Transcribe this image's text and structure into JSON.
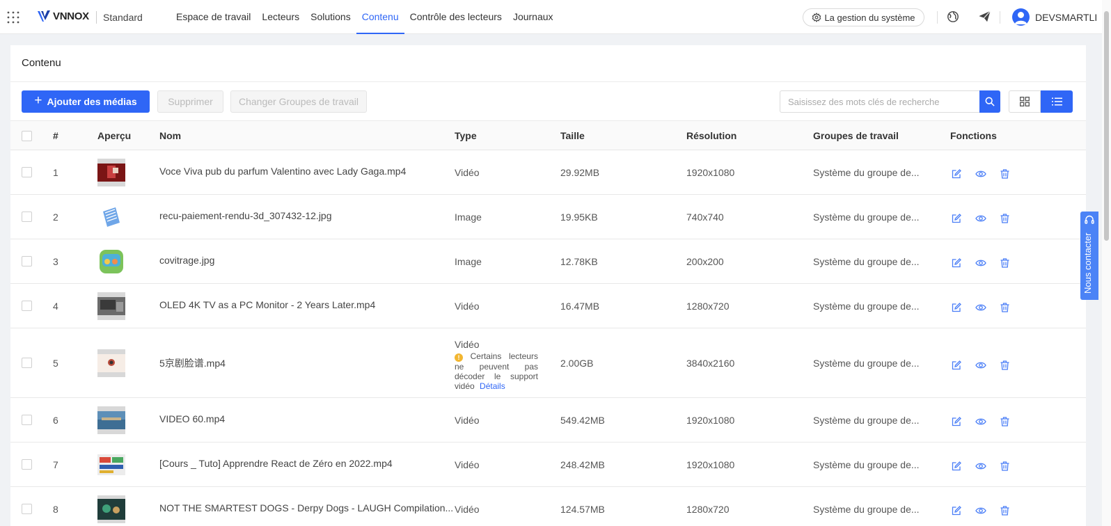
{
  "brand": {
    "name": "VNNOX",
    "edition": "Standard"
  },
  "nav": {
    "items": [
      {
        "label": "Espace de travail",
        "active": false
      },
      {
        "label": "Lecteurs",
        "active": false
      },
      {
        "label": "Solutions",
        "active": false
      },
      {
        "label": "Contenu",
        "active": true
      },
      {
        "label": "Contrôle des lecteurs",
        "active": false
      },
      {
        "label": "Journaux",
        "active": false
      }
    ],
    "system_label": "La gestion du système",
    "username": "DEVSMARTLIG"
  },
  "page": {
    "title": "Contenu"
  },
  "toolbar": {
    "add_label": "Ajouter des médias",
    "delete_label": "Supprimer",
    "change_group_label": "Changer Groupes de travail",
    "search_placeholder": "Saisissez des mots clés de recherche"
  },
  "table": {
    "headers": [
      "#",
      "Aperçu",
      "Nom",
      "Type",
      "Taille",
      "Résolution",
      "Groupes de travail",
      "Fonctions"
    ],
    "rows": [
      {
        "num": "1",
        "name": "Voce Viva pub du parfum Valentino avec Lady Gaga.mp4",
        "type": "Vidéo",
        "size": "29.92MB",
        "resolution": "1920x1080",
        "group": "Système du groupe de..."
      },
      {
        "num": "2",
        "name": "recu-paiement-rendu-3d_307432-12.jpg",
        "type": "Image",
        "size": "19.95KB",
        "resolution": "740x740",
        "group": "Système du groupe de..."
      },
      {
        "num": "3",
        "name": "covitrage.jpg",
        "type": "Image",
        "size": "12.78KB",
        "resolution": "200x200",
        "group": "Système du groupe de..."
      },
      {
        "num": "4",
        "name": "OLED 4K TV as a PC Monitor - 2 Years Later.mp4",
        "type": "Vidéo",
        "size": "16.47MB",
        "resolution": "1280x720",
        "group": "Système du groupe de..."
      },
      {
        "num": "5",
        "name": "5京剧脸谱.mp4",
        "type": "Vidéo",
        "warning": "Certains lecteurs ne peuvent pas décoder le support vidéo",
        "details_label": "Détails",
        "size": "2.00GB",
        "resolution": "3840x2160",
        "group": "Système du groupe de..."
      },
      {
        "num": "6",
        "name": "VIDEO 60.mp4",
        "type": "Vidéo",
        "size": "549.42MB",
        "resolution": "1920x1080",
        "group": "Système du groupe de..."
      },
      {
        "num": "7",
        "name": "[Cours _ Tuto] Apprendre React de Zéro en 2022.mp4",
        "type": "Vidéo",
        "size": "248.42MB",
        "resolution": "1920x1080",
        "group": "Système du groupe de..."
      },
      {
        "num": "8",
        "name": "NOT THE SMARTEST DOGS - Derpy Dogs - LAUGH Compilation...",
        "type": "Vidéo",
        "size": "124.57MB",
        "resolution": "1280x720",
        "group": "Système du groupe de..."
      }
    ]
  },
  "contact": {
    "label": "Nous contacter"
  },
  "colors": {
    "accent": "#2f66f6",
    "warning": "#f2b631"
  },
  "icons": [
    "apps-grid-icon",
    "vnnox-logo-icon",
    "gear-icon",
    "globe-icon",
    "send-icon",
    "user-avatar-icon",
    "plus-icon",
    "search-icon",
    "grid-view-icon",
    "list-view-icon",
    "edit-icon",
    "eye-icon",
    "trash-icon",
    "warning-icon",
    "headset-icon"
  ]
}
